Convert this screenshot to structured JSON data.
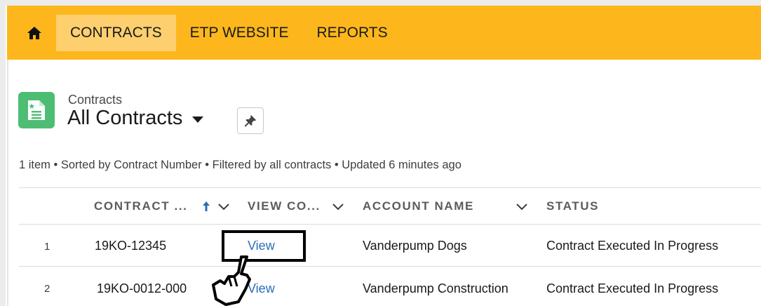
{
  "nav": {
    "home_icon": "home-icon",
    "items": [
      {
        "label": "CONTRACTS",
        "active": true
      },
      {
        "label": "ETP WEBSITE",
        "active": false
      },
      {
        "label": "REPORTS",
        "active": false
      }
    ],
    "bar_color": "#fdb71c",
    "active_color": "#fdcf6e"
  },
  "header": {
    "icon": "contract-document-icon",
    "icon_color": "#4dbd74",
    "object_label": "Contracts",
    "list_view_name": "All Contracts",
    "pin_icon": "pin-icon"
  },
  "list_info": "1 item • Sorted by Contract Number • Filtered by all contracts • Updated 6 minutes ago",
  "table": {
    "columns": [
      {
        "label": "CONTRACT ...",
        "sort": "ascending"
      },
      {
        "label": "VIEW CO..."
      },
      {
        "label": "ACCOUNT NAME"
      },
      {
        "label": "STATUS"
      }
    ],
    "rows": [
      {
        "num": "1",
        "contract": "19KO-12345",
        "view": "View",
        "account": "Vanderpump Dogs",
        "status": "Contract Executed In Progress"
      },
      {
        "num": "2",
        "contract": "19KO-0012-000",
        "view": "View",
        "account": "Vanderpump Construction",
        "status": "Contract Executed In Progress"
      }
    ]
  },
  "annotation": {
    "highlight_target": "View",
    "cursor_icon": "hand-pointer-icon"
  }
}
